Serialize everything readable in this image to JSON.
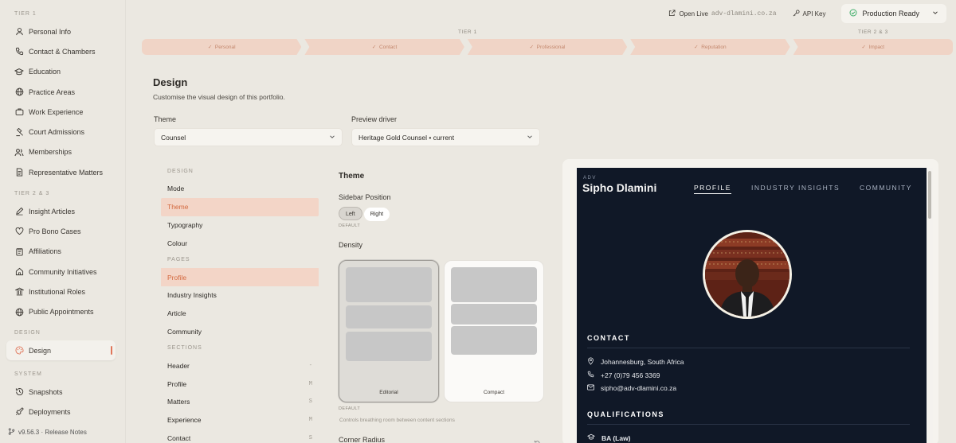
{
  "sidebar": {
    "sections": {
      "tier1": "TIER 1",
      "tier23": "TIER 2 & 3",
      "design": "DESIGN",
      "system": "SYSTEM"
    },
    "tier1_items": [
      "Personal Info",
      "Contact & Chambers",
      "Education",
      "Practice Areas",
      "Work Experience",
      "Court Admissions",
      "Memberships",
      "Representative Matters"
    ],
    "tier23_items": [
      "Insight Articles",
      "Pro Bono Cases",
      "Affiliations",
      "Community Initiatives",
      "Institutional Roles",
      "Public Appointments"
    ],
    "design_item": "Design",
    "system_items": [
      "Snapshots",
      "Deployments"
    ],
    "version": "v9.56.3 · Release Notes"
  },
  "topbar": {
    "open_live": "Open Live",
    "domain": "adv-dlamini.co.za",
    "api_key": "API Key",
    "status": "Production Ready"
  },
  "steps": {
    "tier1": "TIER 1",
    "tier23": "TIER 2 & 3",
    "items": [
      "Personal",
      "Contact",
      "Professional",
      "Reputation",
      "Impact"
    ]
  },
  "header": {
    "title": "Design",
    "subtitle": "Customise the visual design of this portfolio.",
    "theme_label": "Theme",
    "theme_value": "Counsel",
    "driver_label": "Preview driver",
    "driver_value": "Heritage Gold Counsel • current"
  },
  "menu": {
    "design_head": "DESIGN",
    "design_items": [
      "Mode",
      "Theme",
      "Typography",
      "Colour"
    ],
    "pages_head": "PAGES",
    "pages_items": [
      "Profile",
      "Industry Insights",
      "Article",
      "Community"
    ],
    "sections_head": "SECTIONS",
    "sections_items": [
      {
        "label": "Header",
        "key": "-"
      },
      {
        "label": "Profile",
        "key": "M"
      },
      {
        "label": "Matters",
        "key": "S"
      },
      {
        "label": "Experience",
        "key": "M"
      },
      {
        "label": "Contact",
        "key": "S"
      }
    ]
  },
  "options": {
    "title": "Theme",
    "sidebar_position": "Sidebar Position",
    "left": "Left",
    "right": "Right",
    "default1": "DEFAULT",
    "density": "Density",
    "editorial": "Editorial",
    "compact": "Compact",
    "default2": "DEFAULT",
    "density_hint": "Controls breathing room between content sections",
    "corner_radius": "Corner Radius"
  },
  "preview": {
    "prefix": "ADV",
    "name": "Sipho Dlamini",
    "nav": [
      "PROFILE",
      "INDUSTRY INSIGHTS",
      "COMMUNITY"
    ],
    "contact_heading": "CONTACT",
    "location": "Johannesburg, South Africa",
    "phone": "+27 (0)79 456 3369",
    "email": "sipho@adv-dlamini.co.za",
    "qualifications_heading": "QUALIFICATIONS",
    "qualification": "BA (Law)"
  },
  "colors": {
    "accent": "#e0765a",
    "step_bg": "#f0d4c6",
    "preview_bg": "#101827"
  }
}
